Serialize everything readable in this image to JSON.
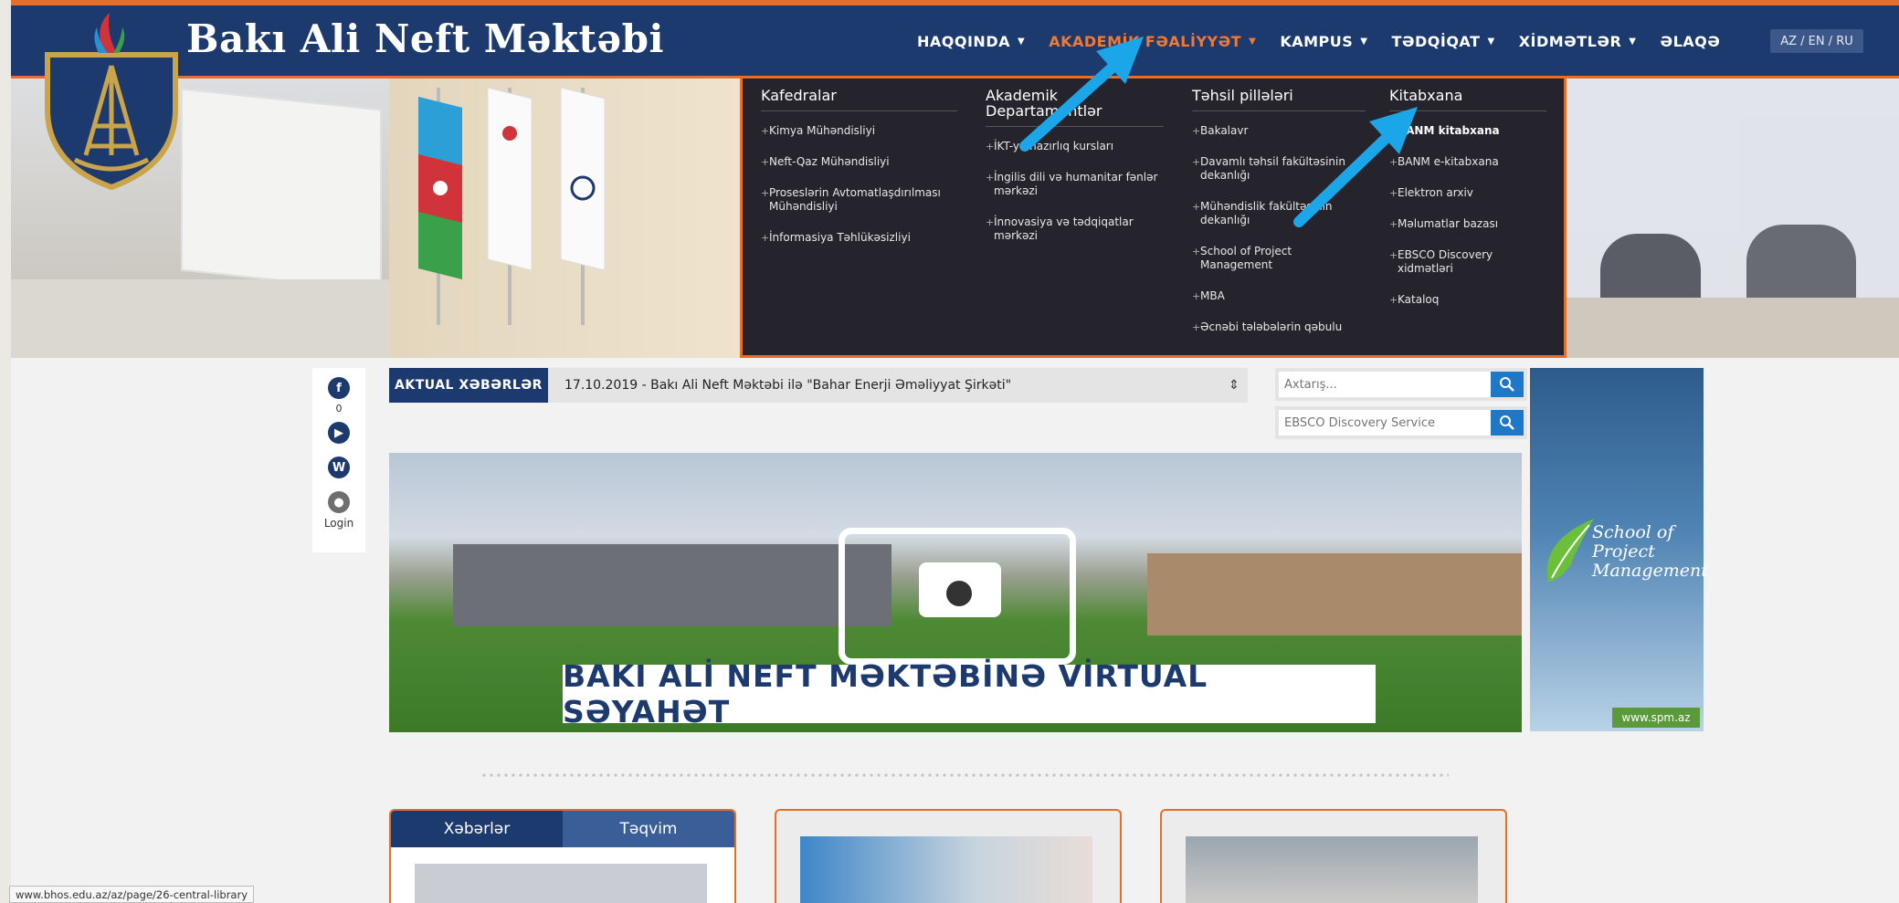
{
  "header": {
    "site_title": "Bakı Ali Neft Məktəbi",
    "lang_switch": "AZ / EN / RU"
  },
  "nav": [
    {
      "label": "HAQQINDA"
    },
    {
      "label": "AKADEMİK FƏALİYYƏT",
      "active": true
    },
    {
      "label": "KAMPUS"
    },
    {
      "label": "TƏDQİQAT"
    },
    {
      "label": "XİDMƏTLƏR"
    },
    {
      "label": "ƏLAQƏ"
    }
  ],
  "mega_menu": {
    "columns": [
      {
        "heading": "Kafedralar",
        "items": [
          "Kimya Mühəndisliyi",
          "Neft-Qaz Mühəndisliyi",
          "Proseslərin Avtomatlaşdırılması Mühəndisliyi",
          "İnformasiya Təhlükəsizliyi"
        ]
      },
      {
        "heading": "Akademik Departamentlər",
        "items": [
          "İKT-yə hazırlıq kursları",
          "İngilis dili və humanitar fənlər mərkəzi",
          "İnnovasiya və tədqiqatlar mərkəzi"
        ]
      },
      {
        "heading": "Təhsil pillələri",
        "items": [
          "Bakalavr",
          "Davamlı təhsil fakültəsinin dekanlığı",
          "Mühəndislik fakültəsinin dekanlığı",
          "School of Project Management",
          "MBA",
          "Əcnəbi tələbələrin qəbulu"
        ]
      },
      {
        "heading": "Kitabxana",
        "items": [
          "BANM kitabxana",
          "BANM e-kitabxana",
          "Elektron arxiv",
          "Məlumatlar bazası",
          "EBSCO Discovery xidmətləri",
          "Kataloq"
        ]
      }
    ]
  },
  "social": {
    "facebook_count": "0",
    "login_label": "Login"
  },
  "ticker": {
    "label": "AKTUAL XƏBƏRLƏR",
    "text": "17.10.2019 - Bakı Ali Neft Məktəbi ilə \"Bahar Enerji Əməliyyat Şirkəti\""
  },
  "search": {
    "placeholder": "Axtarış...",
    "ebsco_placeholder": "EBSCO Discovery Service"
  },
  "ad": {
    "title_line1": "School of",
    "title_line2": "Project",
    "title_line3": "Management",
    "url": "www.spm.az"
  },
  "hero": {
    "banner_text": "BAKI ALİ NEFT MƏKTƏBİNƏ VİRTUAL SƏYAHƏT"
  },
  "news_tabs": {
    "tab1": "Xəbərlər",
    "tab2": "Təqvim"
  },
  "status_bar": {
    "url": "www.bhos.edu.az/az/page/26-central-library"
  },
  "colors": {
    "navy": "#1c3a6e",
    "accent_orange": "#e46f2a",
    "annotation_arrow": "#1aa6e8",
    "search_button": "#1e78c8"
  }
}
